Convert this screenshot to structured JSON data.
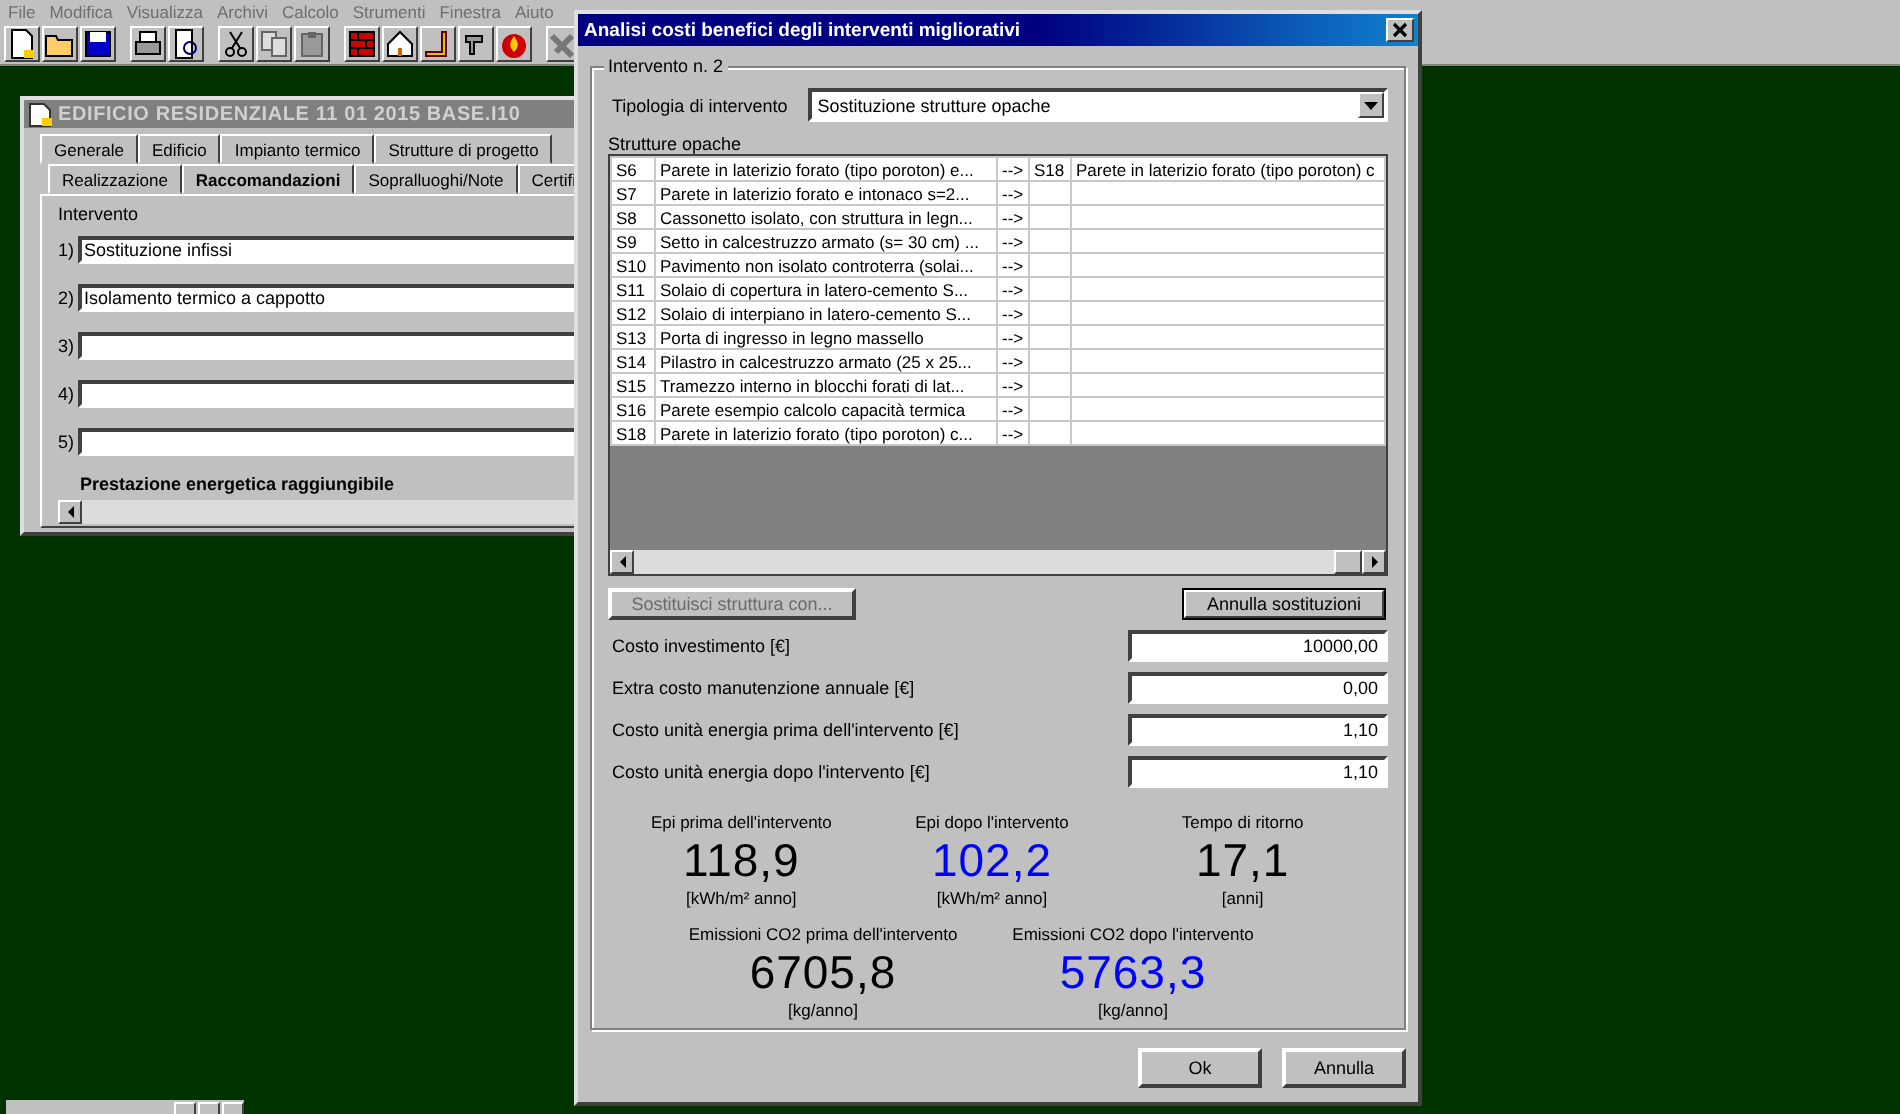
{
  "menu": [
    "File",
    "Modifica",
    "Visualizza",
    "Archivi",
    "Calcolo",
    "Strumenti",
    "Finestra",
    "Aiuto"
  ],
  "document_window": {
    "title": "EDIFICIO RESIDENZIALE 11 01 2015 BASE.I10",
    "tabs_row_1": [
      {
        "label": "Generale",
        "selected": false
      },
      {
        "label": "Edificio",
        "selected": false
      },
      {
        "label": "Impianto termico",
        "selected": false
      },
      {
        "label": "Strutture di progetto",
        "selected": false
      }
    ],
    "tabs_row_2": [
      {
        "label": "Realizzazione",
        "selected": false
      },
      {
        "label": "Raccomandazioni",
        "selected": true
      },
      {
        "label": "Sopralluoghi/Note",
        "selected": false
      },
      {
        "label": "Certifi",
        "selected": false
      }
    ],
    "section_label": "Intervento",
    "interventions": [
      {
        "number": "1)",
        "value": "Sostituzione infissi"
      },
      {
        "number": "2)",
        "value": "Isolamento termico a cappotto"
      },
      {
        "number": "3)"
      },
      {
        "number": "4)"
      },
      {
        "number": "5)"
      }
    ],
    "footer_label": "Prestazione energetica raggiungibile"
  },
  "dialog": {
    "title": "Analisi costi benefici degli interventi migliorativi",
    "group_title": "Intervento n. 2",
    "type_label": "Tipologia di intervento",
    "type_value": "Sostituzione strutture opache",
    "table_label": "Strutture opache",
    "table_rows": [
      {
        "code": "S6",
        "description": "Parete in laterizio forato (tipo poroton) e...",
        "arrow": "-->",
        "replacement_code": "S18",
        "replacement_description": "Parete in laterizio forato (tipo poroton) c"
      },
      {
        "code": "S7",
        "description": "Parete in laterizio forato e intonaco s=2...",
        "arrow": "-->"
      },
      {
        "code": "S8",
        "description": "Cassonetto isolato, con struttura in legn...",
        "arrow": "-->"
      },
      {
        "code": "S9",
        "description": "Setto in calcestruzzo armato (s= 30 cm) ...",
        "arrow": "-->"
      },
      {
        "code": "S10",
        "description": "Pavimento non isolato controterra (solai...",
        "arrow": "-->"
      },
      {
        "code": "S11",
        "description": "Solaio di copertura in latero-cemento S...",
        "arrow": "-->"
      },
      {
        "code": "S12",
        "description": "Solaio di interpiano in latero-cemento S...",
        "arrow": "-->"
      },
      {
        "code": "S13",
        "description": "Porta di ingresso in legno massello",
        "arrow": "-->"
      },
      {
        "code": "S14",
        "description": "Pilastro in calcestruzzo armato (25 x 25...",
        "arrow": "-->"
      },
      {
        "code": "S15",
        "description": "Tramezzo interno in blocchi forati di lat...",
        "arrow": "-->"
      },
      {
        "code": "S16",
        "description": "Parete esempio calcolo capacità termica",
        "arrow": "-->"
      },
      {
        "code": "S18",
        "description": "Parete in laterizio forato (tipo poroton) c...",
        "arrow": "-->"
      }
    ],
    "action_buttons": [
      {
        "label": "Sostituisci struttura con...",
        "disabled": true,
        "focused": false
      },
      {
        "label": "Annulla sostituzioni",
        "disabled": false,
        "focused": true
      }
    ],
    "fields": [
      {
        "label": "Costo investimento [€]",
        "value": "10000,00"
      },
      {
        "label": "Extra costo manutenzione annuale [€]",
        "value": "0,00"
      },
      {
        "label": "Costo unità energia prima dell'intervento [€]",
        "value": "1,10"
      },
      {
        "label": "Costo unità energia dopo l'intervento [€]",
        "value": "1,10"
      }
    ],
    "result_rows": [
      {
        "items": [
          {
            "label": "Epi prima dell'intervento",
            "value": "118,9",
            "unit": "[kWh/m² anno]",
            "color": "#000000"
          },
          {
            "label": "Epi dopo l'intervento",
            "value": "102,2",
            "unit": "[kWh/m² anno]",
            "color": "#0000ff"
          },
          {
            "label": "Tempo di ritorno",
            "value": "17,1",
            "unit": "[anni]",
            "color": "#000000"
          }
        ]
      },
      {
        "items": [
          {
            "label": "Emissioni CO2 prima dell'intervento",
            "value": "6705,8",
            "unit": "[kg/anno]",
            "color": "#000000"
          },
          {
            "label": "Emissioni CO2 dopo l'intervento",
            "value": "5763,3",
            "unit": "[kg/anno]",
            "color": "#0000ff"
          }
        ]
      }
    ],
    "buttons": [
      "Ok",
      "Annulla"
    ]
  }
}
